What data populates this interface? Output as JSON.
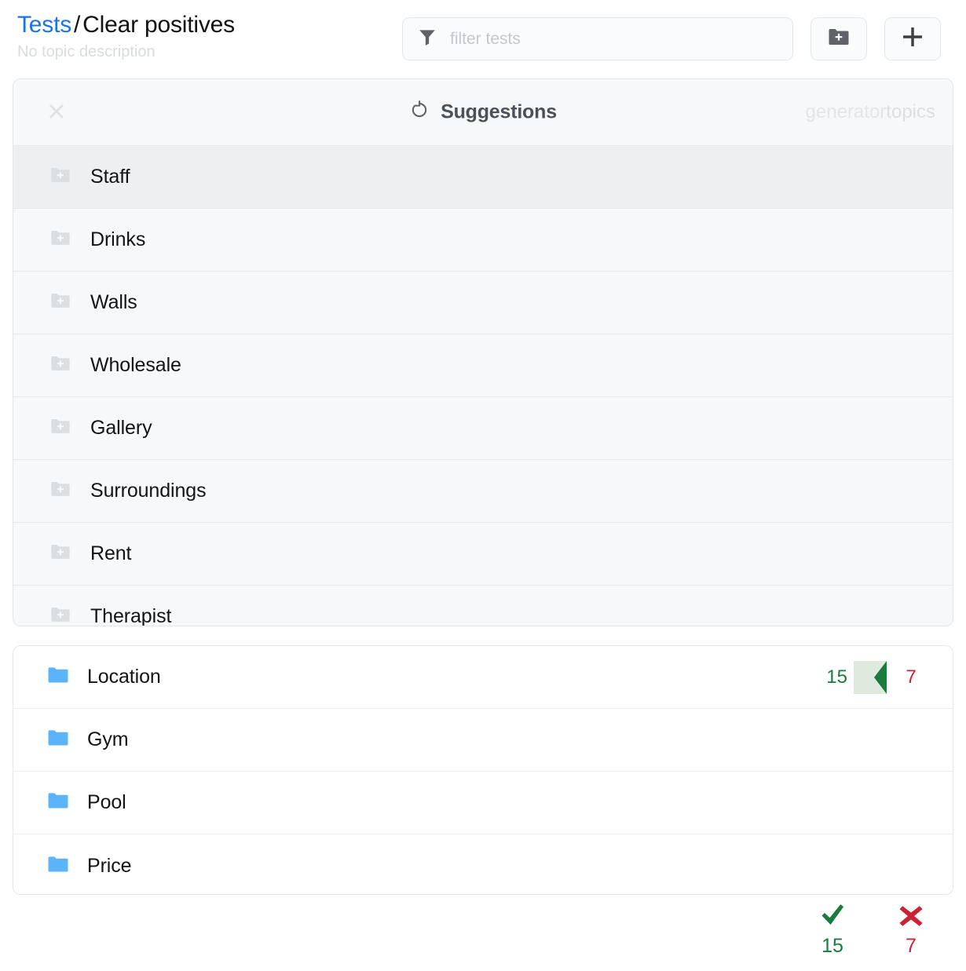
{
  "header": {
    "breadcrumb": {
      "root": "Tests",
      "separator": "/",
      "current": "Clear positives"
    },
    "topic_description": "No topic description",
    "filter": {
      "value": "",
      "placeholder": "filter tests",
      "icon": "funnel-icon"
    },
    "new_folder_button": {
      "icon": "folder-plus-icon"
    },
    "add_button": {
      "icon": "plus-icon"
    }
  },
  "suggestions": {
    "title": "Suggestions",
    "refresh_icon": "refresh-icon",
    "close_icon": "close-icon",
    "tags": {
      "generator": "generator",
      "topics": "topics"
    },
    "items": [
      {
        "label": "Staff",
        "icon": "folder-plus-icon",
        "active": true
      },
      {
        "label": "Drinks",
        "icon": "folder-plus-icon",
        "active": false
      },
      {
        "label": "Walls",
        "icon": "folder-plus-icon",
        "active": false
      },
      {
        "label": "Wholesale",
        "icon": "folder-plus-icon",
        "active": false
      },
      {
        "label": "Gallery",
        "icon": "folder-plus-icon",
        "active": false
      },
      {
        "label": "Surroundings",
        "icon": "folder-plus-icon",
        "active": false
      },
      {
        "label": "Rent",
        "icon": "folder-plus-icon",
        "active": false
      },
      {
        "label": "Therapist",
        "icon": "folder-plus-icon",
        "active": false
      }
    ]
  },
  "topics": {
    "items": [
      {
        "label": "Location",
        "icon": "folder-icon",
        "pass": "15",
        "fail": "7",
        "has_scores": true
      },
      {
        "label": "Gym",
        "icon": "folder-icon",
        "pass": "",
        "fail": "",
        "has_scores": false
      },
      {
        "label": "Pool",
        "icon": "folder-icon",
        "pass": "",
        "fail": "",
        "has_scores": false
      },
      {
        "label": "Price",
        "icon": "folder-icon",
        "pass": "",
        "fail": "",
        "has_scores": false
      }
    ]
  },
  "totals": {
    "pass": {
      "icon": "check-icon",
      "count": "15"
    },
    "fail": {
      "icon": "cross-icon",
      "count": "7"
    }
  },
  "colors": {
    "link": "#1a73e8",
    "folder_blue": "#5ab4f7",
    "pass_green": "#1a7b3c",
    "pass_green_bg": "#dfeade",
    "fail_red": "#cc2233",
    "muted": "#d9dcdf"
  }
}
